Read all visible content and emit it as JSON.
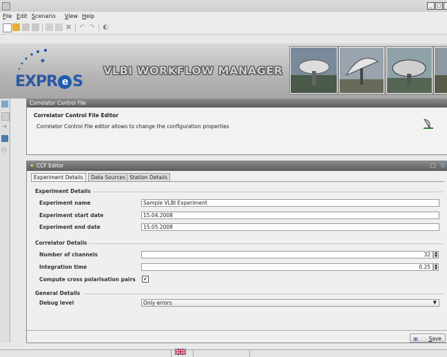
{
  "menu": {
    "items": [
      {
        "label": "File",
        "mnemonic": "F",
        "rest": "ile"
      },
      {
        "label": "Edit",
        "mnemonic": "E",
        "rest": "dit"
      },
      {
        "label": "Scenario",
        "mnemonic": "S",
        "rest": "cenario"
      },
      {
        "label": "View",
        "mnemonic": "V",
        "rest": "iew"
      },
      {
        "label": "Help",
        "mnemonic": "H",
        "rest": "elp"
      }
    ]
  },
  "banner": {
    "logo_pre": "EXPR",
    "logo_o": "e",
    "logo_post": "S",
    "title": "VLBI WORKFLOW MANAGER"
  },
  "ccf_panel": {
    "header": "Correlator Control File",
    "title": "Correlator Control File Editor",
    "description": "Correlator Control File editor allows to change the configuration properties"
  },
  "editor": {
    "header": "CCF Editor",
    "tabs": [
      {
        "label": "Experiment Details",
        "active": true
      },
      {
        "label": "Data Sources",
        "active": false
      },
      {
        "label": "Station Details",
        "active": false
      }
    ],
    "experiment": {
      "section": "Experiment Details",
      "name_label": "Experiment name",
      "name_value": "Sample VLBI Experiment",
      "start_label": "Experiment start date",
      "start_value": "15.04.2008",
      "end_label": "Experiment end date",
      "end_value": "15.05.2008"
    },
    "correlator": {
      "section": "Correlator Details",
      "channels_label": "Number of channels",
      "channels_value": "32",
      "integration_label": "Integration time",
      "integration_value": "0.25",
      "crosspol_label": "Compute cross polarisation pairs",
      "crosspol_checked": true
    },
    "general": {
      "section": "General Details",
      "debug_label": "Debug level",
      "debug_value": "Only errors"
    },
    "save_label": "Save",
    "save_mnemonic": "S",
    "save_rest": "ave"
  },
  "colors": {
    "header_dark": "#5c5c5c",
    "logo_blue": "#2a5aa8"
  }
}
